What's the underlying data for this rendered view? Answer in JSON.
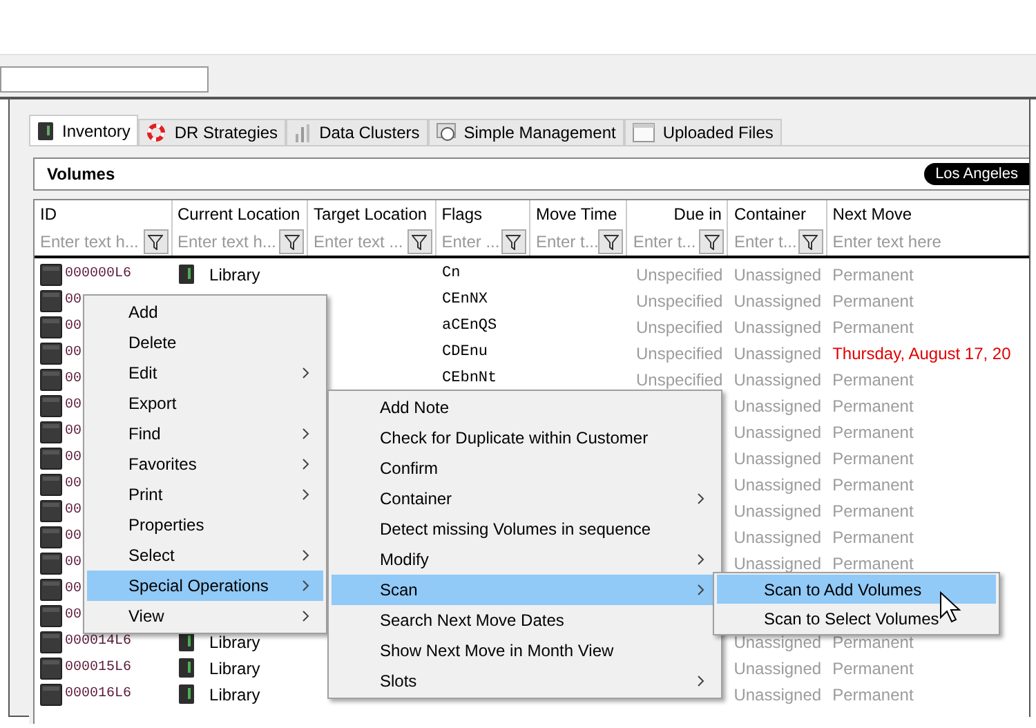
{
  "tabs": [
    {
      "label": "Inventory",
      "selected": true
    },
    {
      "label": "DR Strategies",
      "selected": false
    },
    {
      "label": "Data Clusters",
      "selected": false
    },
    {
      "label": "Simple Management",
      "selected": false
    },
    {
      "label": "Uploaded Files",
      "selected": false
    }
  ],
  "panel": {
    "title": "Volumes",
    "location_badge": "Los Angeles"
  },
  "table": {
    "columns": [
      {
        "label": "ID",
        "placeholder": "Enter text h...",
        "filter": true
      },
      {
        "label": "Current Location",
        "placeholder": "Enter text h...",
        "filter": true
      },
      {
        "label": "Target Location",
        "placeholder": "Enter text ...",
        "filter": true
      },
      {
        "label": "Flags",
        "placeholder": "Enter ...",
        "filter": true
      },
      {
        "label": "Move Time",
        "placeholder": "Enter t...",
        "filter": true
      },
      {
        "label": "Due in",
        "placeholder": "Enter t...",
        "filter": true
      },
      {
        "label": "Container",
        "placeholder": "Enter t...",
        "filter": true
      },
      {
        "label": "Next Move",
        "placeholder": "Enter text here",
        "filter": false
      }
    ],
    "rows": [
      {
        "id": "000000L6",
        "current_location": "Library",
        "flags": "Cn",
        "due_in": "Unspecified",
        "container": "Unassigned",
        "next_move": "Permanent",
        "alert": false
      },
      {
        "id": "00",
        "flags": "CEnNX",
        "due_in": "Unspecified",
        "container": "Unassigned",
        "next_move": "Permanent",
        "alert": false
      },
      {
        "id": "00",
        "flags": "aCEnQS",
        "due_in": "Unspecified",
        "container": "Unassigned",
        "next_move": "Permanent",
        "alert": false
      },
      {
        "id": "00",
        "flags": "CDEnu",
        "due_in": "Unspecified",
        "container": "Unassigned",
        "next_move": "Thursday, August 17, 20",
        "alert": true
      },
      {
        "id": "00",
        "flags": "CEbnNt",
        "due_in": "Unspecified",
        "container": "Unassigned",
        "next_move": "Permanent",
        "alert": false
      },
      {
        "id": "00",
        "container": "Unassigned",
        "next_move": "Permanent",
        "alert": false
      },
      {
        "id": "00",
        "container": "Unassigned",
        "next_move": "Permanent",
        "alert": false
      },
      {
        "id": "00",
        "container": "Unassigned",
        "next_move": "Permanent",
        "alert": false
      },
      {
        "id": "00",
        "container": "Unassigned",
        "next_move": "Permanent",
        "alert": false
      },
      {
        "id": "00",
        "container": "Unassigned",
        "next_move": "Permanent",
        "alert": false
      },
      {
        "id": "00",
        "container": "Unassigned",
        "next_move": "Permanent",
        "alert": false
      },
      {
        "id": "00",
        "container": "Unassigned",
        "next_move": "Permanent",
        "alert": false
      },
      {
        "id": "00"
      },
      {
        "id": "00"
      },
      {
        "id": "000014L6",
        "current_location": "Library",
        "container": "Unassigned",
        "next_move": "Permanent",
        "alert": false
      },
      {
        "id": "000015L6",
        "current_location": "Library",
        "container": "Unassigned",
        "next_move": "Permanent",
        "alert": false
      },
      {
        "id": "000016L6",
        "current_location": "Library",
        "container": "Unassigned",
        "next_move": "Permanent",
        "alert": false
      }
    ]
  },
  "menus": [
    {
      "items": [
        {
          "label": "Add",
          "submenu": false,
          "selected": false
        },
        {
          "label": "Delete",
          "submenu": false,
          "selected": false
        },
        {
          "label": "Edit",
          "submenu": true,
          "selected": false
        },
        {
          "label": "Export",
          "submenu": false,
          "selected": false
        },
        {
          "label": "Find",
          "submenu": true,
          "selected": false
        },
        {
          "label": "Favorites",
          "submenu": true,
          "selected": false
        },
        {
          "label": "Print",
          "submenu": true,
          "selected": false
        },
        {
          "label": "Properties",
          "submenu": false,
          "selected": false
        },
        {
          "label": "Select",
          "submenu": true,
          "selected": false
        },
        {
          "label": "Special Operations",
          "submenu": true,
          "selected": true
        },
        {
          "label": "View",
          "submenu": true,
          "selected": false
        }
      ]
    },
    {
      "items": [
        {
          "label": "Add Note",
          "submenu": false,
          "selected": false
        },
        {
          "label": "Check for Duplicate within Customer",
          "submenu": false,
          "selected": false
        },
        {
          "label": "Confirm",
          "submenu": false,
          "selected": false
        },
        {
          "label": "Container",
          "submenu": true,
          "selected": false
        },
        {
          "label": "Detect missing Volumes in sequence",
          "submenu": false,
          "selected": false
        },
        {
          "label": "Modify",
          "submenu": true,
          "selected": false
        },
        {
          "label": "Scan",
          "submenu": true,
          "selected": true
        },
        {
          "label": "Search Next Move Dates",
          "submenu": false,
          "selected": false
        },
        {
          "label": "Show Next Move in Month View",
          "submenu": false,
          "selected": false
        },
        {
          "label": "Slots",
          "submenu": true,
          "selected": false
        }
      ]
    },
    {
      "items": [
        {
          "label": "Scan to Add Volumes",
          "submenu": false,
          "selected": true
        },
        {
          "label": "Scan to Select Volumes",
          "submenu": false,
          "selected": false
        }
      ]
    }
  ]
}
